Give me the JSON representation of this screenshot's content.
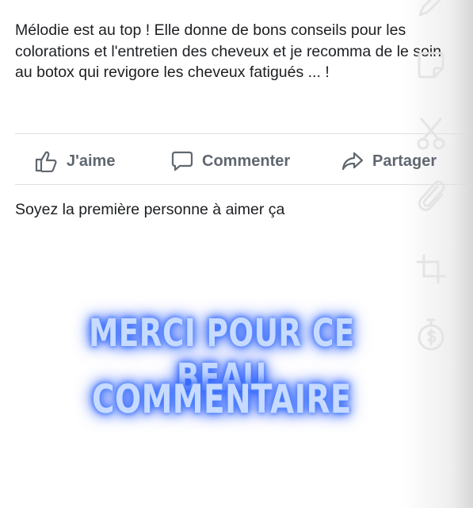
{
  "post": {
    "text": "Mélodie est au top ! Elle donne de bons conseils pour les colorations et l'entretien des cheveux et je recomma de le soin au botox qui revigore les cheveux fatigués ... !"
  },
  "actions": {
    "like_label": "J'aime",
    "comment_label": "Commenter",
    "share_label": "Partager"
  },
  "reactions": {
    "first_like_text": "Soyez la première personne à aimer ça"
  },
  "overlay": {
    "line1": "MERCI POUR CE BEAU",
    "line2": "COMMENTAIRE",
    "glow_color": "#3d73ff"
  },
  "editor_tools": [
    "pencil-icon",
    "sticker-icon",
    "scissors-icon",
    "paperclip-icon",
    "crop-icon",
    "timer-icon"
  ]
}
